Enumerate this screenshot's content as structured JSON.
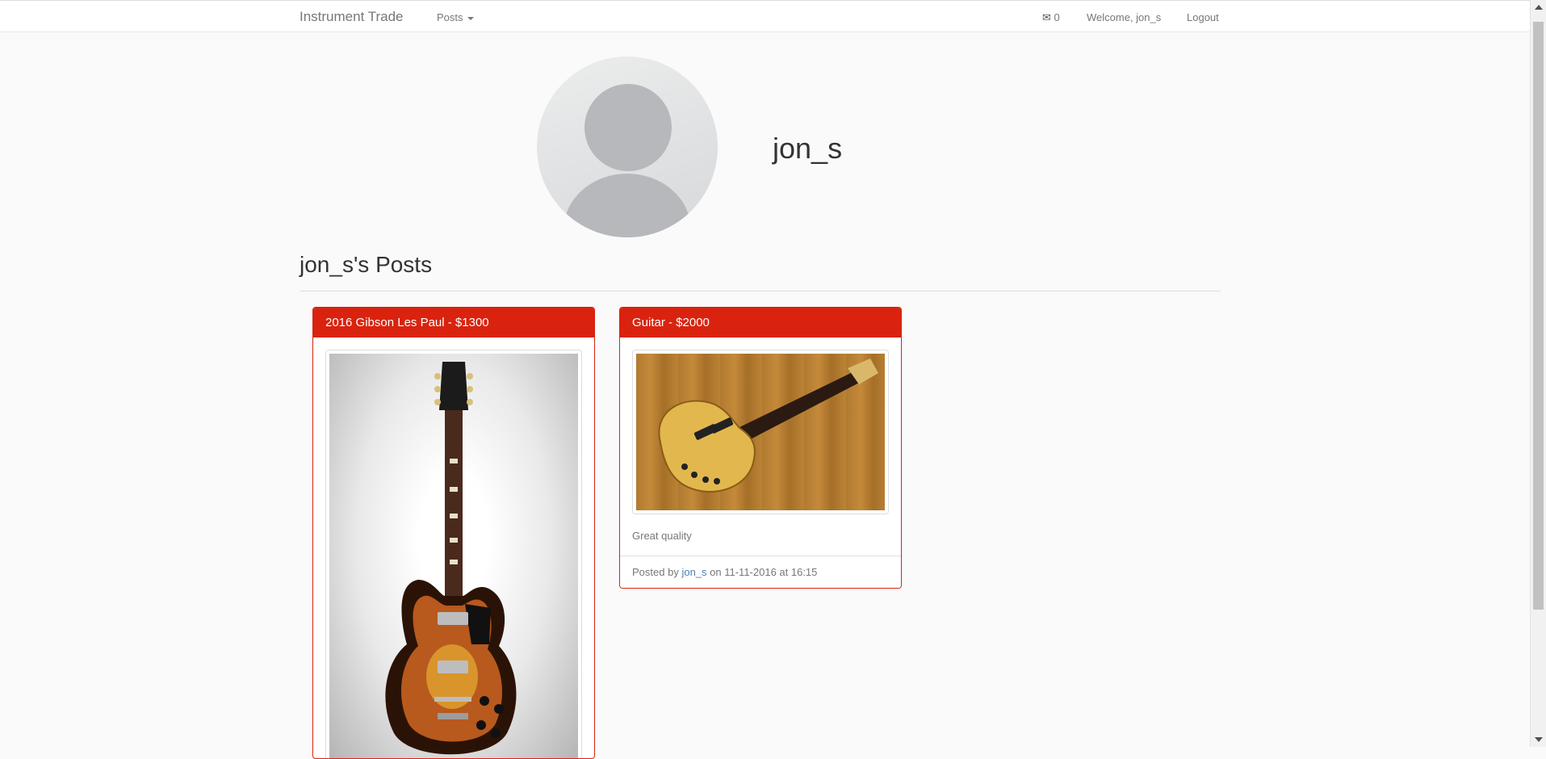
{
  "navbar": {
    "brand": "Instrument Trade",
    "posts_menu": "Posts",
    "mail_count": "0",
    "welcome": "Welcome, jon_s",
    "logout": "Logout"
  },
  "profile": {
    "username": "jon_s",
    "posts_heading": "jon_s's Posts"
  },
  "posts": [
    {
      "title": "2016 Gibson Les Paul - $1300"
    },
    {
      "title": "Guitar - $2000",
      "description": "Great quality",
      "footer": {
        "prefix": "Posted by",
        "author": "jon_s",
        "suffix": "on 11-11-2016 at 16:15"
      }
    }
  ],
  "colors": {
    "accent": "#d9230f",
    "link": "#4a7fb5",
    "background": "#fafafa"
  }
}
